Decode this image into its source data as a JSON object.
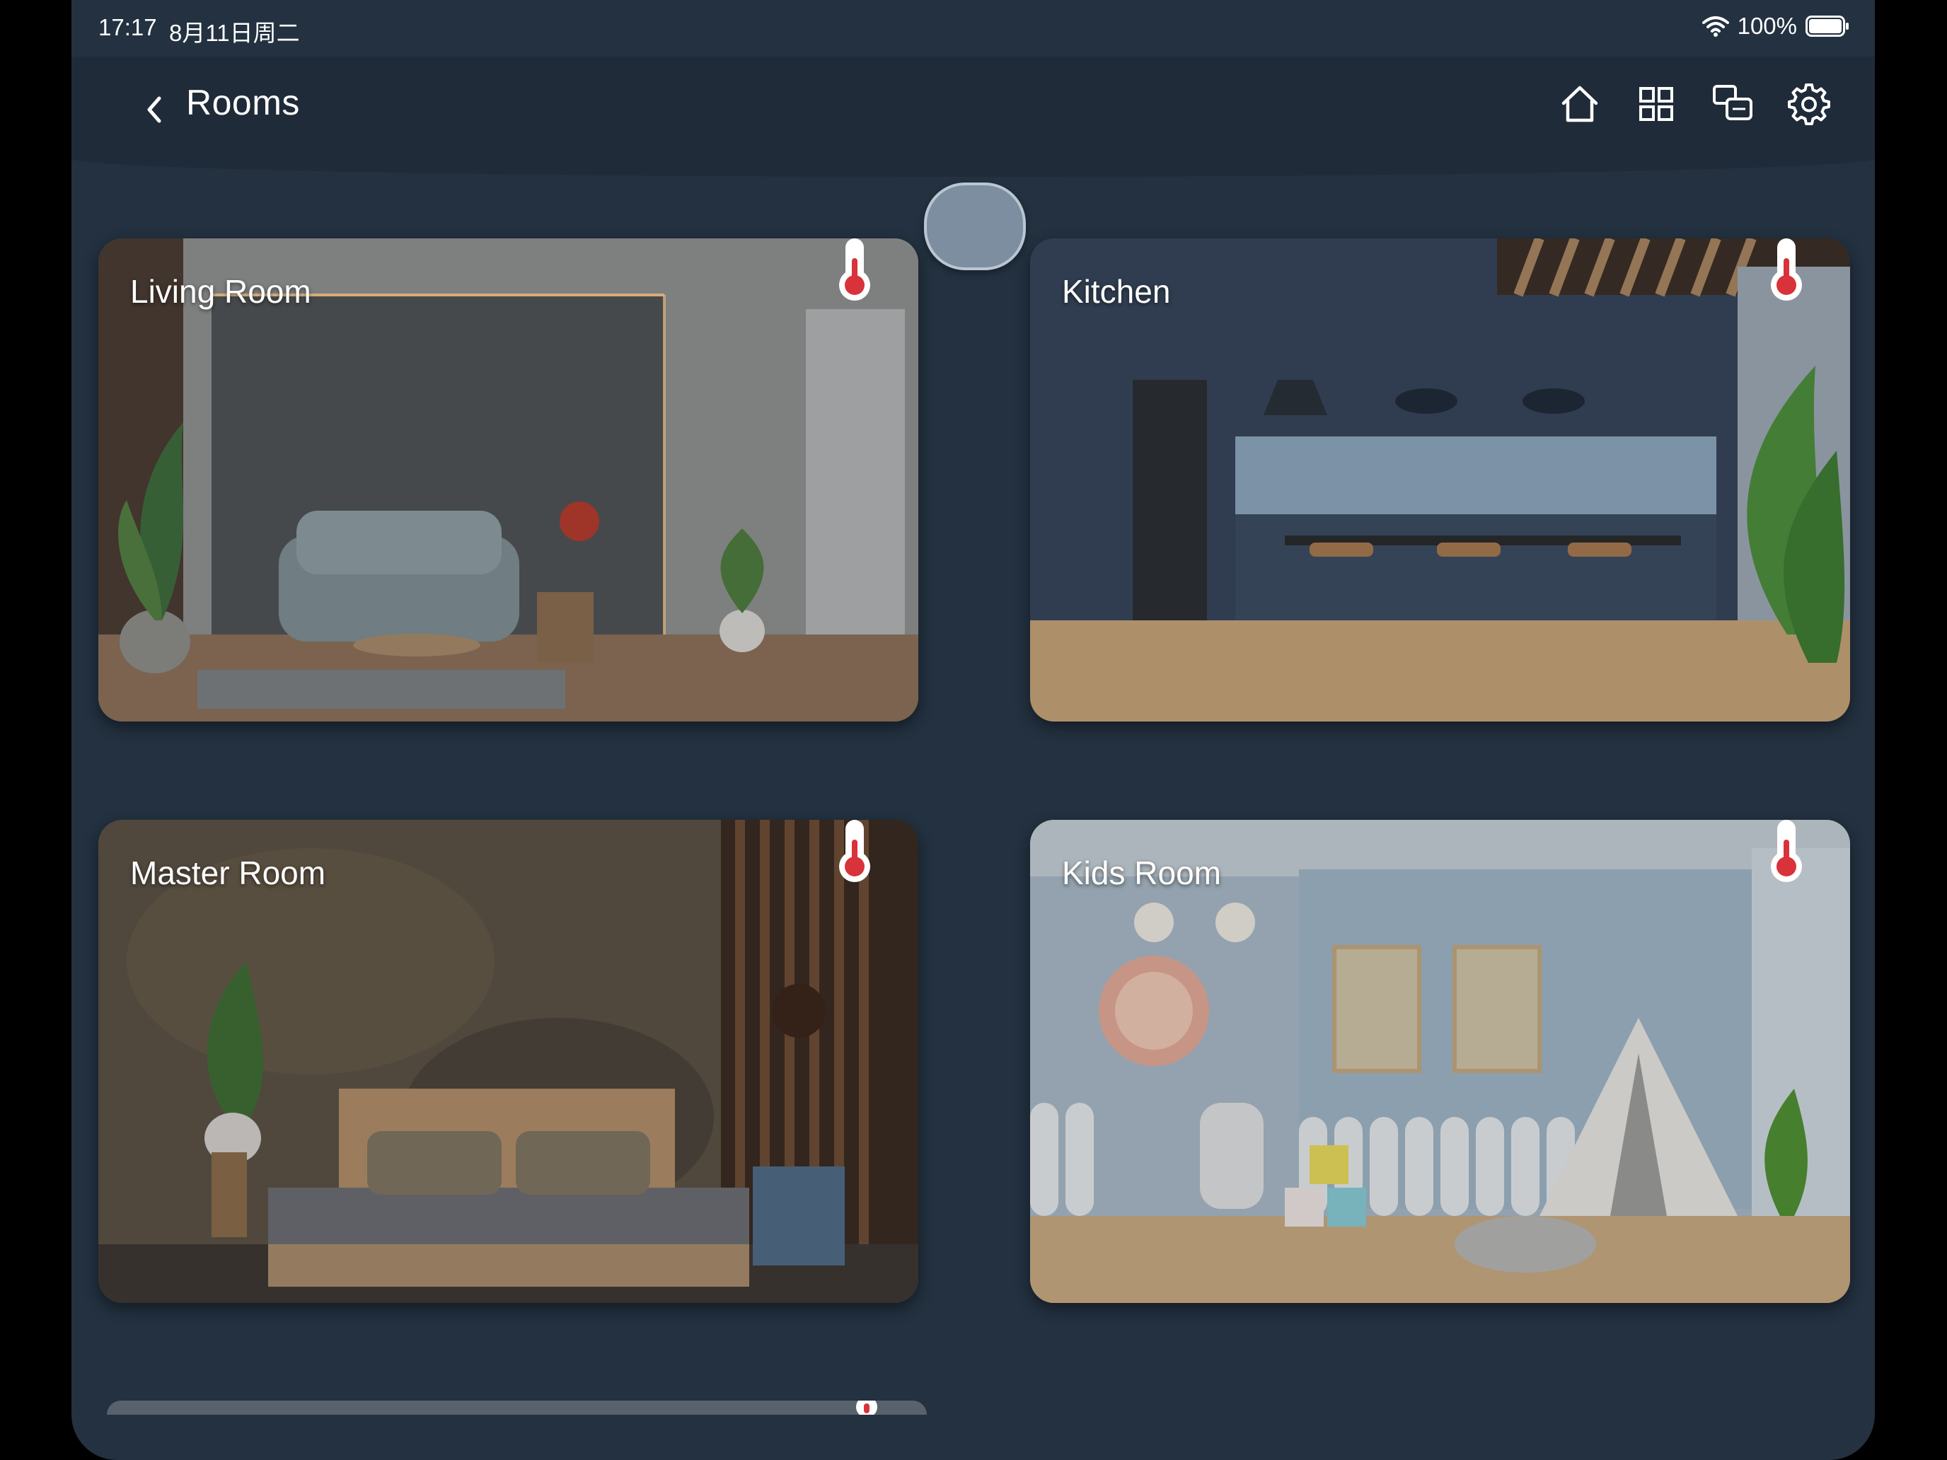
{
  "status_bar": {
    "time": "17:17",
    "date": "8月11日周二",
    "battery": "100%"
  },
  "header": {
    "title": "Rooms",
    "icons": [
      "chevron-left-icon",
      "home-icon",
      "grid-icon",
      "devices-icon",
      "gear-icon"
    ]
  },
  "rooms": [
    {
      "name": "Living Room",
      "icon": "thermometer-icon"
    },
    {
      "name": "Kitchen",
      "icon": "thermometer-icon"
    },
    {
      "name": "Master Room",
      "icon": "thermometer-icon"
    },
    {
      "name": "Kids Room",
      "icon": "thermometer-icon"
    }
  ],
  "colors": {
    "background": "#233140",
    "header": "#1f2b39",
    "thermometer_red": "#d8323a",
    "text": "#ffffff"
  }
}
